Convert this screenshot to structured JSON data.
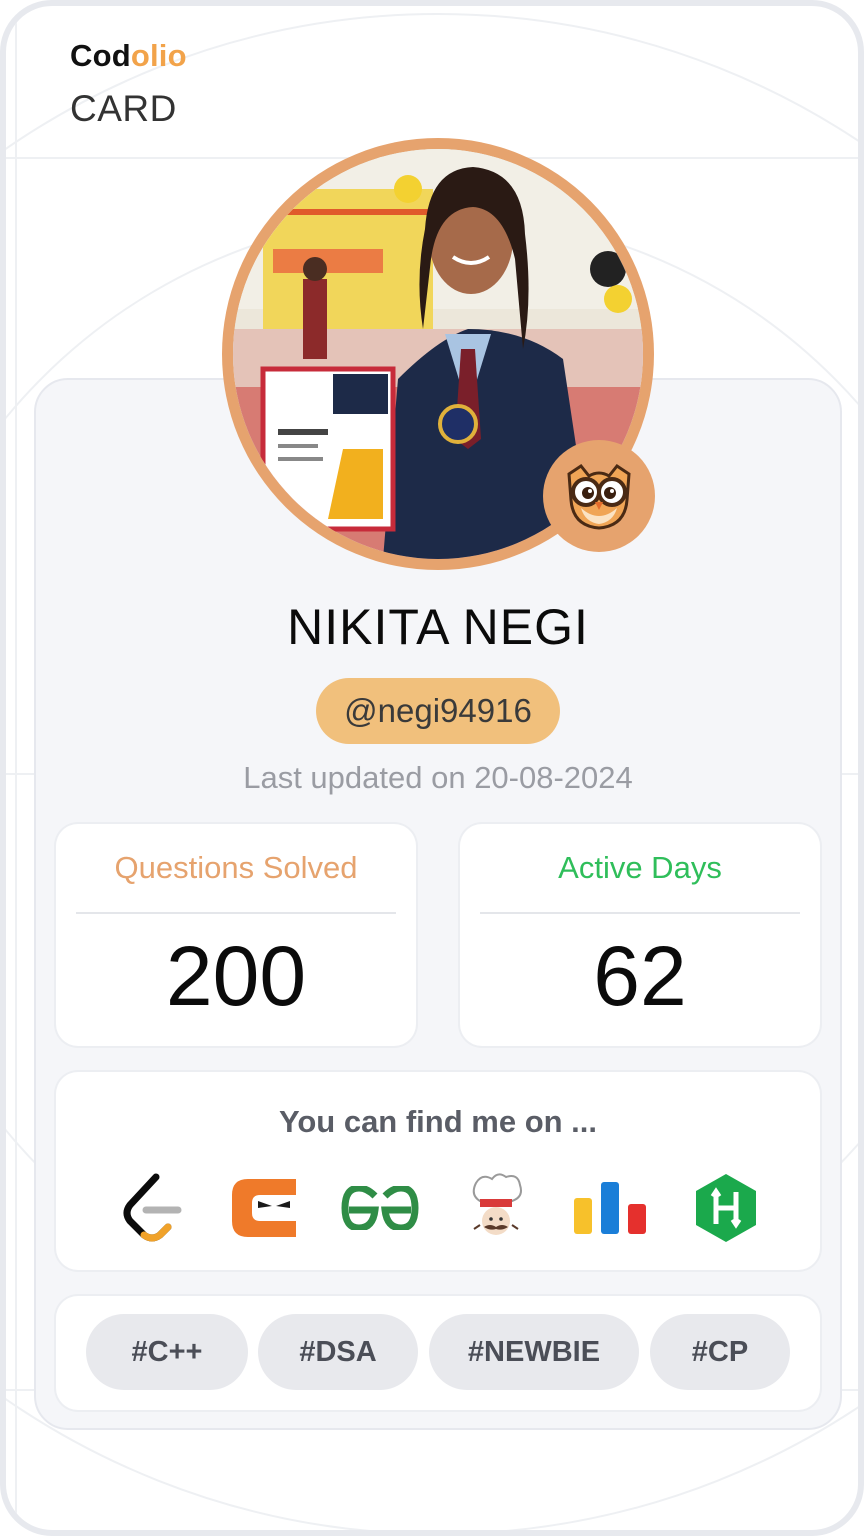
{
  "brand": {
    "name_part1": "Cod",
    "name_part2": "olio",
    "card_label": "CARD"
  },
  "profile": {
    "name": "NIKITA NEGI",
    "handle": "@negi94916",
    "last_updated": "Last updated on 20-08-2024",
    "avatar_badge_icon": "owl-icon"
  },
  "stats": {
    "questions_solved": {
      "label": "Questions Solved",
      "value": "200"
    },
    "active_days": {
      "label": "Active Days",
      "value": "62"
    }
  },
  "find_me": {
    "title": "You can find me on ...",
    "platforms": [
      {
        "name": "LeetCode",
        "icon": "leetcode-icon"
      },
      {
        "name": "Coding Ninjas",
        "icon": "codingninjas-icon"
      },
      {
        "name": "GeeksforGeeks",
        "icon": "geeksforgeeks-icon"
      },
      {
        "name": "CodeChef",
        "icon": "codechef-icon"
      },
      {
        "name": "Codeforces",
        "icon": "codeforces-icon"
      },
      {
        "name": "HackerRank",
        "icon": "hackerrank-icon"
      }
    ]
  },
  "tags": [
    "#C++",
    "#DSA",
    "#NEWBIE",
    "#CP"
  ],
  "colors": {
    "accent_orange": "#e6a36e",
    "handle_bg": "#f1c07c",
    "active_green": "#2fbe5a",
    "brand_orange": "#f2a34a"
  }
}
